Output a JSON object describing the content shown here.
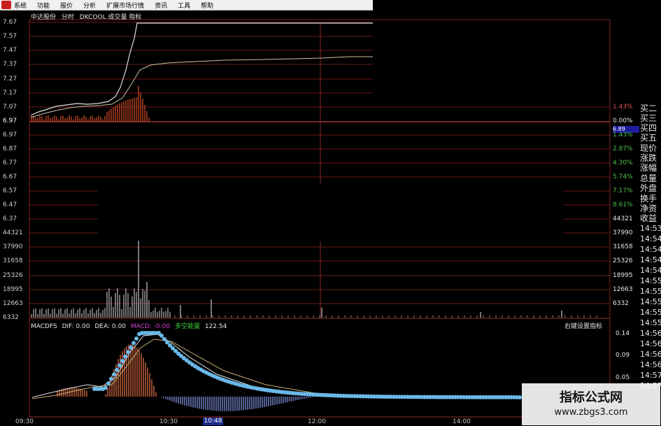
{
  "menubar": {
    "items": [
      "系统",
      "功能",
      "报价",
      "分析",
      "扩展市场行情",
      "资讯",
      "工具",
      "帮助"
    ]
  },
  "chart_header": {
    "stock_name": "中达股份",
    "period": "分时",
    "indicator": "DKCOOL 成交量 指标"
  },
  "left_axis": {
    "prices_top": [
      "7.67",
      "7.57",
      "7.47",
      "7.37",
      "7.27",
      "7.17",
      "7.07",
      "6.97"
    ],
    "prices_bottom": [
      "6.97",
      "6.87",
      "6.77",
      "6.67",
      "6.57",
      "6.47",
      "6.37"
    ],
    "volume": [
      "44321",
      "37990",
      "31658",
      "25326",
      "18995",
      "12663",
      "6332"
    ]
  },
  "right_axis": {
    "percents": [
      "1.43%",
      "0.00%",
      "1.43%",
      "2.87%",
      "4.30%",
      "5.74%",
      "7.17%",
      "8.61%",
      "44321"
    ],
    "volume": [
      "37990",
      "31658",
      "25326",
      "18995",
      "12663",
      "6332"
    ],
    "current_price": "6.89"
  },
  "quote_labels": [
    "买二",
    "买三",
    "买四",
    "买五",
    "现价",
    "涨跌",
    "涨幅",
    "总量",
    "外盘",
    "换手",
    "净资",
    "收益"
  ],
  "tick_times": [
    "14:53",
    "14:54",
    "14:54",
    "14:54",
    "14:54",
    "14:55",
    "14:55",
    "14:55",
    "14:55",
    "14:55",
    "14:56",
    "14:56",
    "14:56",
    "14:56",
    "14:57",
    "14:57"
  ],
  "macd": {
    "name": "MACDFS",
    "dif": "DIF: 0.00",
    "dea": "DEA: 0.00",
    "macd": "MACD: -0.00",
    "signal": "多空能量",
    "value": "122.54",
    "right_label": "右键设置指标",
    "axis": [
      "0.14",
      "0.09",
      "0.05"
    ]
  },
  "time_axis": [
    "09:30",
    "10:30",
    "10:48",
    "12:00",
    "14:00"
  ],
  "watermark": {
    "title": "指标公式网",
    "url": "www.zbgs3.com"
  },
  "colors": {
    "grid": "#6a1a1a",
    "up_bar": "#b04020",
    "macd_dots": "#6ab8e8",
    "price_line": "#e0e0e0",
    "avg_line": "#c8c0a0"
  }
}
